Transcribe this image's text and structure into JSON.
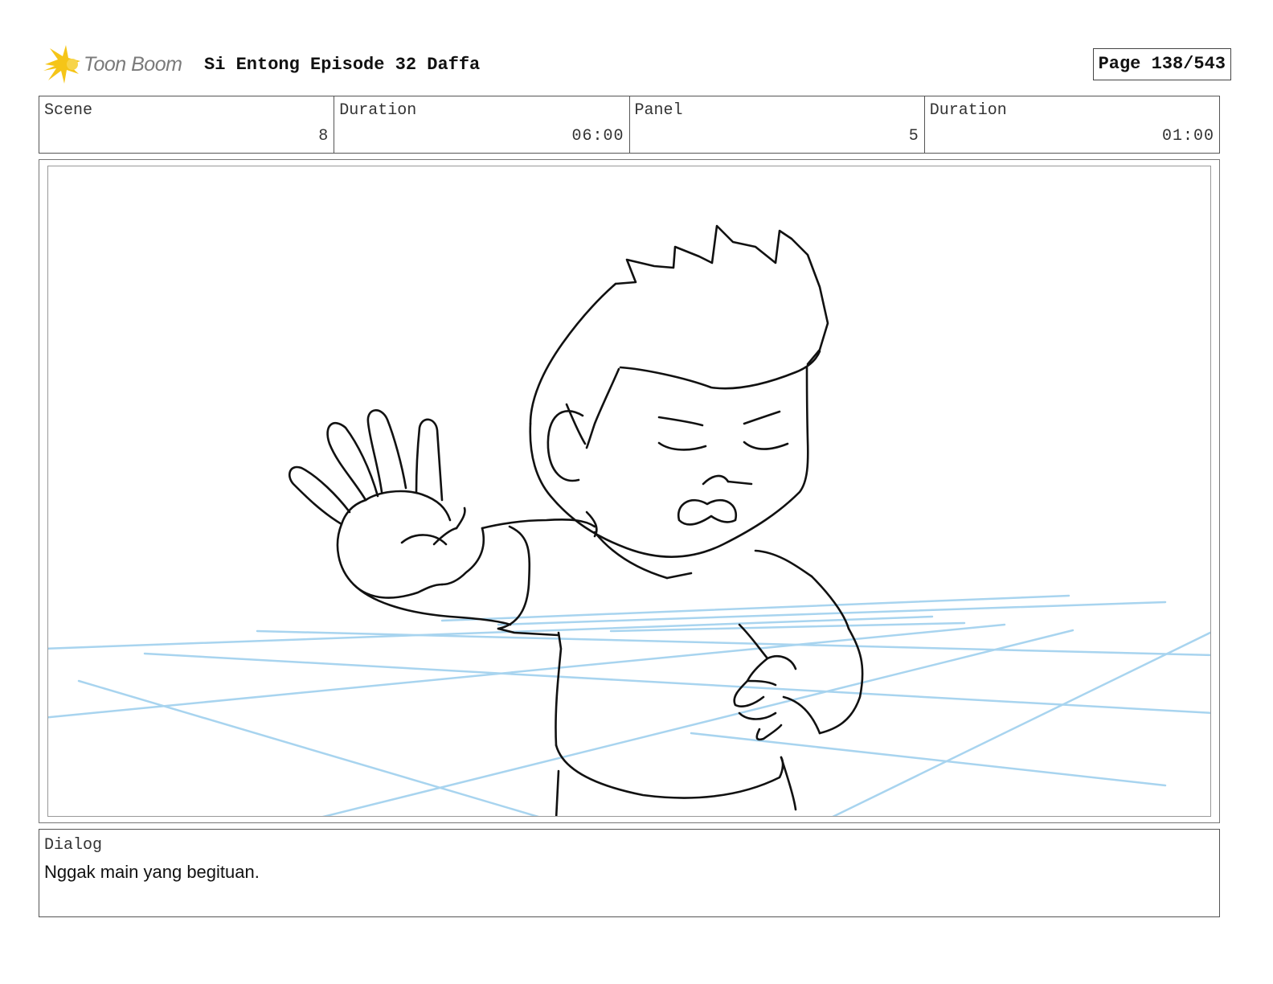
{
  "header": {
    "logo_text": "Toon Boom",
    "project_title": "Si Entong Episode 32 Daffa",
    "page_label": "Page 138/543"
  },
  "info": {
    "scene_label": "Scene",
    "scene_value": "8",
    "scene_duration_label": "Duration",
    "scene_duration_value": "06:00",
    "panel_label": "Panel",
    "panel_value": "5",
    "panel_duration_label": "Duration",
    "panel_duration_value": "01:00"
  },
  "dialog": {
    "label": "Dialog",
    "text": "Nggak main yang begituan."
  },
  "colors": {
    "logo_burst": "#f5c518",
    "perspective_lines": "#a8d4ef",
    "sketch_ink": "#111111"
  },
  "icons": {
    "logo": "toon-boom-burst-icon"
  }
}
